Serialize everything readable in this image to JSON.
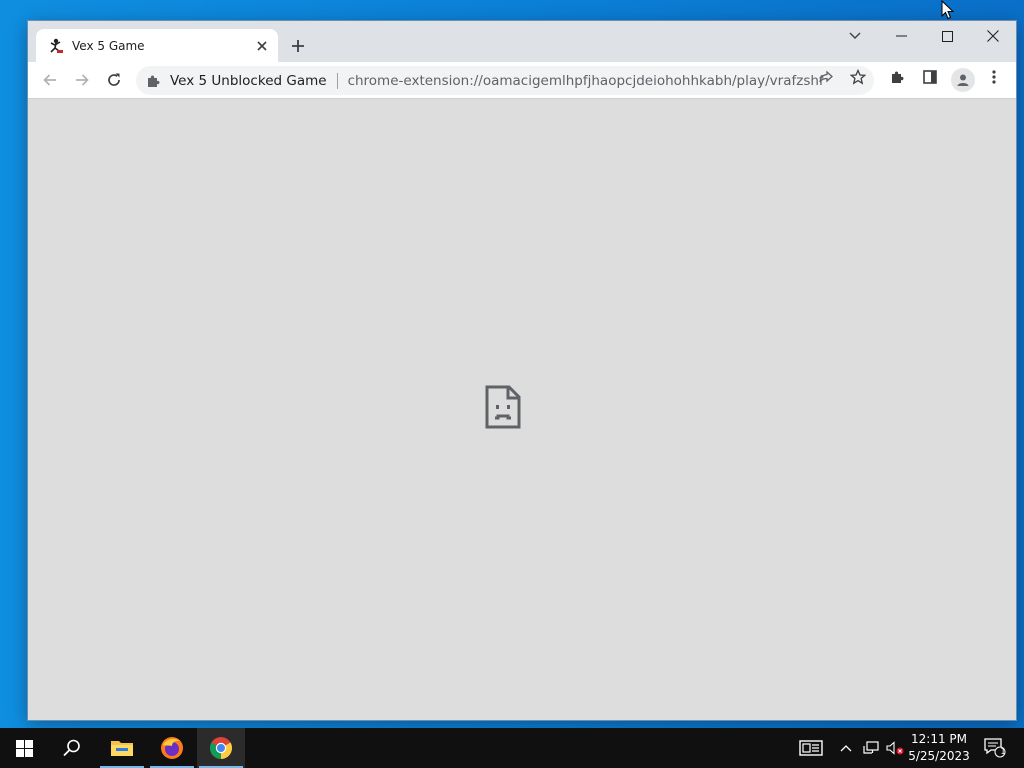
{
  "browser": {
    "tab": {
      "title": "Vex 5 Game",
      "close_icon": "close-icon"
    },
    "new_tab_icon": "plus-icon",
    "window_controls": [
      "tab-search-chevron-icon",
      "minimize-icon",
      "maximize-icon",
      "close-icon"
    ],
    "toolbar": {
      "back_icon": "arrow-left-icon",
      "forward_icon": "arrow-right-icon",
      "reload_icon": "reload-icon",
      "site_name": "Vex 5 Unblocked Game",
      "url": "chrome-extension://oamacigemlhpfjhaopcjdeiohohhkabh/play/vrafzshfe/in...",
      "share_icon": "share-icon",
      "bookmark_icon": "star-icon",
      "extensions_icon": "puzzle-icon",
      "side_panel_icon": "side-panel-icon",
      "profile_icon": "profile-icon",
      "menu_icon": "kebab-menu-icon"
    },
    "content": {
      "state": "sad-page-icon"
    }
  },
  "taskbar": {
    "apps": [
      "windows-start-icon",
      "search-icon",
      "file-explorer-icon",
      "firefox-icon",
      "chrome-icon"
    ],
    "tray_icons": [
      "news-icon",
      "chevron-up-icon",
      "network-icon",
      "volume-muted-icon"
    ],
    "clock": {
      "time": "12:11 PM",
      "date": "5/25/2023"
    },
    "notifications": {
      "count": "1"
    }
  },
  "colors": {
    "desktop": "#0b7fd6",
    "tabstrip": "#dee1e6",
    "content_bg": "#dddddd",
    "taskbar": "#101010",
    "accent_underline": "#76b9ed"
  }
}
